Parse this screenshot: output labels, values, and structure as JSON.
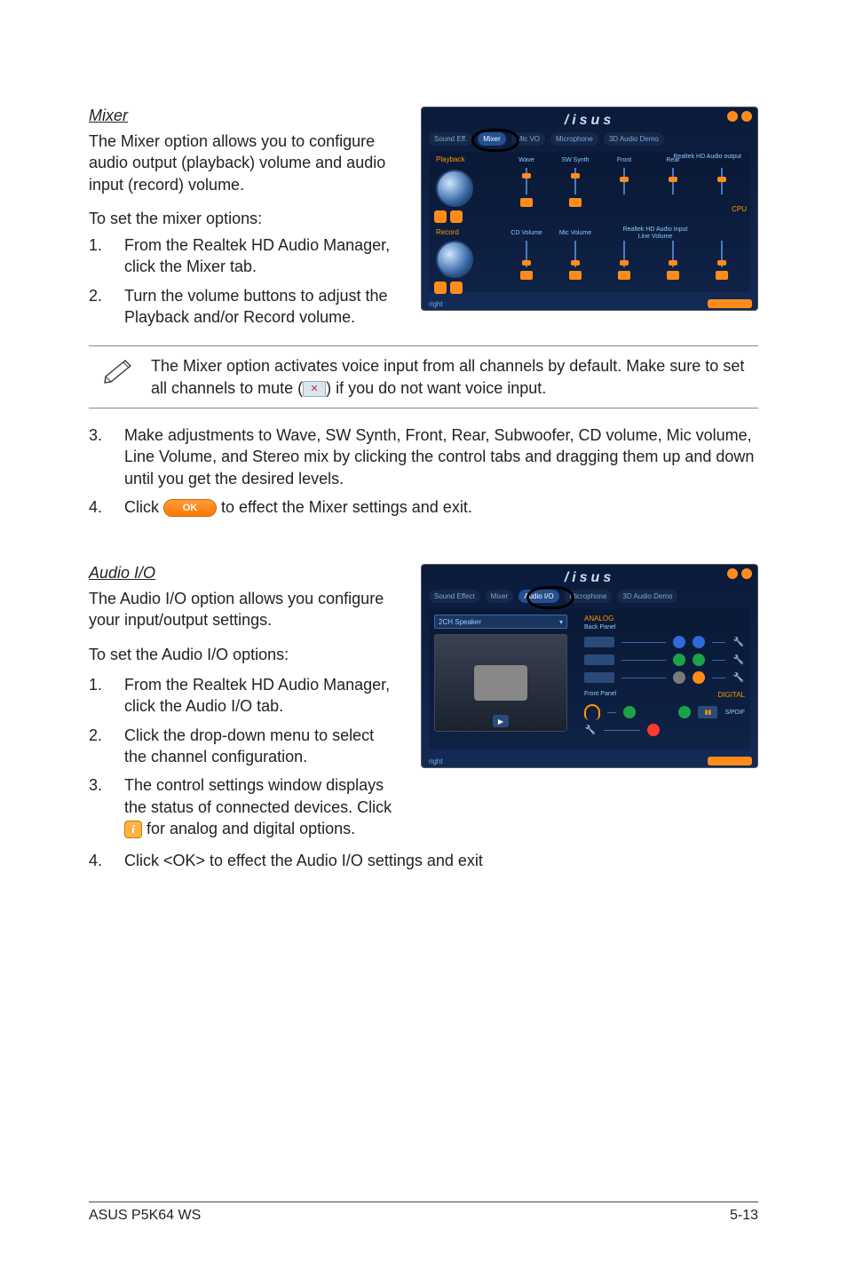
{
  "mixer": {
    "heading": "Mixer",
    "intro": "The Mixer option allows you to configure audio output (playback) volume and audio input (record) volume.",
    "toSet": "To set the mixer options:",
    "steps12": [
      "From the Realtek HD Audio Manager, click the Mixer tab.",
      "Turn the volume buttons to adjust the Playback and/or Record volume."
    ],
    "note_a": "The Mixer option activates voice input from all channels by default. Make sure to set all channels to mute (",
    "note_b": ") if you do not want voice input.",
    "steps34": [
      "Make adjustments to Wave, SW Synth, Front, Rear, Subwoofer, CD volume, Mic volume, Line Volume, and Stereo mix by clicking the control tabs and dragging them up and down until you get the desired levels.",
      "Click            to effect the Mixer settings and exit."
    ],
    "step4_a": "Click ",
    "step4_b": " to effect the Mixer settings and exit.",
    "panel": {
      "brand": "/isus",
      "tabs": [
        "Sound Eff.",
        "Mixer",
        "Mic VO",
        "Microphone",
        "3D Audio Demo"
      ],
      "active_tab": "Mixer",
      "row1_label": "Playback",
      "row2_label": "Record",
      "row1_header": "Realtek HD Audio output",
      "row2_header_a": "Realtek HD Audio Input",
      "row2_header_b": "Line Volume",
      "row1_cols": [
        "Wave",
        "SW Synth",
        "Front",
        "Rear"
      ],
      "row2_cols": [
        "CD Volume",
        "Mic Volume",
        "",
        ""
      ],
      "cpu": "CPU",
      "footer_label": "right"
    }
  },
  "audioio": {
    "heading": "Audio I/O",
    "intro": "The Audio I/O option allows you configure your input/output settings.",
    "toSet": "To set the Audio I/O options:",
    "steps": [
      "From the Realtek HD Audio Manager, click the Audio I/O tab.",
      "Click the drop-down menu to select the channel configuration.",
      "The control settings window displays the status of connected devices. Click      for analog and digital options."
    ],
    "step3_a": "The control settings window displays the status of connected devices. Click ",
    "step3_b": " for analog and digital options.",
    "step4": "Click <OK> to effect the Audio I/O settings and exit",
    "panel": {
      "brand": "/isus",
      "tabs": [
        "Sound Effect",
        "Mixer",
        "Audio I/O",
        "Microphone",
        "3D Audio Demo"
      ],
      "active_tab": "Audio I/O",
      "dropdown": "2CH Speaker",
      "analog_label": "ANALOG",
      "back_label": "Back Panel",
      "front_label": "Front Panel",
      "digital_label": "DIGITAL",
      "spdif_label": "S/PDIF",
      "footer_label": "right",
      "jack_colors": [
        "#2e6bd6",
        "#2e6bd6",
        "#1aa34a",
        "#1aa34a",
        "#7a7a7a",
        "#ff8c1a"
      ]
    }
  },
  "icons": {
    "mute": "✕",
    "ok": "OK",
    "info": "i"
  },
  "footer": {
    "left": "ASUS P5K64 WS",
    "right": "5-13"
  }
}
